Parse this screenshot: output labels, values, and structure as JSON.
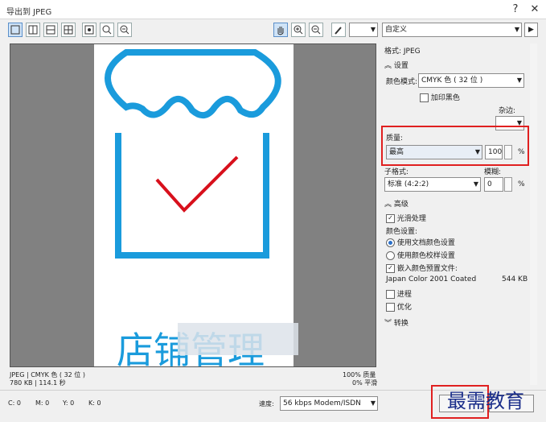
{
  "window": {
    "title": "导出到 JPEG",
    "help_glyph": "?",
    "close_glyph": "✕"
  },
  "toolbar": {
    "preset_value": "自定义",
    "next_glyph": "▶"
  },
  "panel": {
    "format_label": "格式: JPEG",
    "settings_header": "设置",
    "color_mode_label": "颜色模式:",
    "color_mode_value": "CMYK 色 ( 32 位 )",
    "overprint_black_label": "加印黑色",
    "matte_label": "杂边:",
    "quality_label": "质量:",
    "quality_value": "最高",
    "quality_number": "100",
    "percent": "%",
    "subformat_label": "子格式:",
    "subformat_value": "标准 (4:2:2)",
    "blur_label": "模糊:",
    "blur_number": "0",
    "advanced_header": "高级",
    "anti_alias_label": "光滑处理",
    "color_settings_label": "颜色设置:",
    "radio_doc_color": "使用文档颜色设置",
    "radio_proof_color": "使用颜色校样设置",
    "embed_profile_label": "嵌入颜色预置文件:",
    "profile_name": "Japan Color 2001 Coated",
    "profile_size": "544 KB",
    "progressive_label": "进程",
    "optimize_label": "优化",
    "transform_header": "转换"
  },
  "preview": {
    "text": "店铺管理"
  },
  "status": {
    "left_line1": "JPEG | CMYK 色 ( 32 位 )",
    "left_line2": "780 KB | 114.1 秒",
    "right_line1": "100% 质量",
    "right_line2": "0% 平滑",
    "c": "C: 0",
    "m": "M: 0",
    "y": "Y: 0",
    "k": "K: 0",
    "speed_label": "速度:",
    "speed_value": "56 kbps Modem/ISDN"
  },
  "watermark": "最需教育",
  "colors": {
    "accent": "#1a9bdc",
    "check": "#d8101c",
    "highlight": "#e02020"
  }
}
